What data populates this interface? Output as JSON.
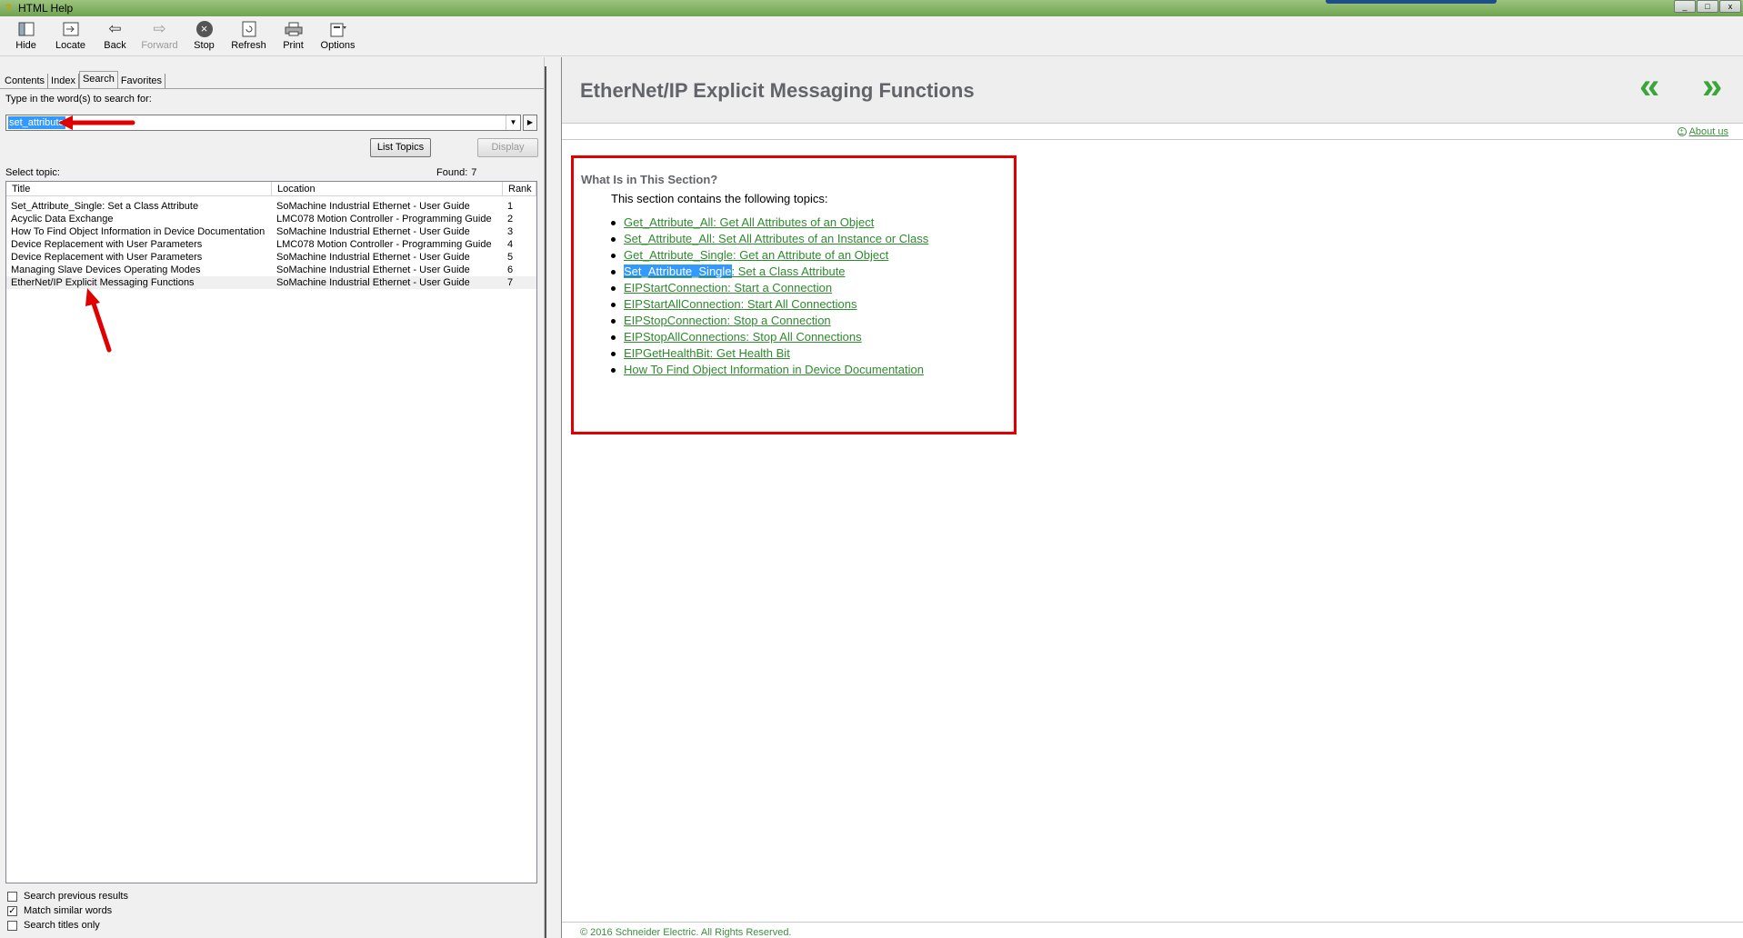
{
  "window": {
    "title": "HTML Help",
    "controls": [
      "_",
      "□",
      "x"
    ]
  },
  "toolbar": {
    "hide": "Hide",
    "locate": "Locate",
    "back": "Back",
    "forward": "Forward",
    "stop": "Stop",
    "refresh": "Refresh",
    "print": "Print",
    "options": "Options"
  },
  "tabs": [
    "Contents",
    "Index",
    "Search",
    "Favorites"
  ],
  "search": {
    "prompt": "Type in the word(s) to search for:",
    "value": "set_attribute",
    "list_topics": "List Topics",
    "display": "Display",
    "select_topic": "Select topic:",
    "found_label": "Found:",
    "found_count": "7"
  },
  "results": {
    "columns": [
      "Title",
      "Location",
      "Rank"
    ],
    "rows": [
      {
        "title": "Set_Attribute_Single: Set a Class Attribute",
        "location": "SoMachine Industrial Ethernet - User Guide",
        "rank": "1"
      },
      {
        "title": "Acyclic Data Exchange",
        "location": "LMC078 Motion Controller - Programming Guide",
        "rank": "2"
      },
      {
        "title": "How To Find Object Information in Device Documentation",
        "location": "SoMachine Industrial Ethernet - User Guide",
        "rank": "3"
      },
      {
        "title": "Device Replacement with User Parameters",
        "location": "LMC078 Motion Controller - Programming Guide",
        "rank": "4"
      },
      {
        "title": "Device Replacement with User Parameters",
        "location": "SoMachine Industrial Ethernet - User Guide",
        "rank": "5"
      },
      {
        "title": "Managing Slave Devices Operating Modes",
        "location": "SoMachine Industrial Ethernet - User Guide",
        "rank": "6"
      },
      {
        "title": "EtherNet/IP Explicit Messaging Functions",
        "location": "SoMachine Industrial Ethernet - User Guide",
        "rank": "7"
      }
    ],
    "selected_index": 6
  },
  "options": {
    "search_previous": {
      "label": "Search previous results",
      "checked": false
    },
    "match_similar": {
      "label": "Match similar words",
      "checked": true
    },
    "titles_only": {
      "label": "Search titles only",
      "checked": false
    }
  },
  "content": {
    "heading": "EtherNet/IP Explicit Messaging Functions",
    "about": "About us",
    "section_title": "What Is in This Section?",
    "section_intro": "This section contains the following topics:",
    "topics": [
      {
        "text": "Get_Attribute_All: Get All Attributes of an Object"
      },
      {
        "text": "Set_Attribute_All: Set All Attributes of an Instance or Class"
      },
      {
        "text": "Get_Attribute_Single: Get an Attribute of an Object"
      },
      {
        "highlight": "Set_Attribute_Single",
        "text": ": Set a Class Attribute"
      },
      {
        "text": "EIPStartConnection: Start a Connection"
      },
      {
        "text": "EIPStartAllConnection: Start All Connections"
      },
      {
        "text": "EIPStopConnection: Stop a Connection"
      },
      {
        "text": "EIPStopAllConnections: Stop All Connections"
      },
      {
        "text": "EIPGetHealthBit: Get Health Bit"
      },
      {
        "text": "How To Find Object Information in Device Documentation"
      }
    ],
    "footer": "© 2016 Schneider Electric. All Rights Reserved."
  },
  "colors": {
    "link": "#2e8b2e",
    "nav_arrows": "#3aa63a",
    "annotation_red": "#e00000",
    "selection": "#3399ff"
  }
}
